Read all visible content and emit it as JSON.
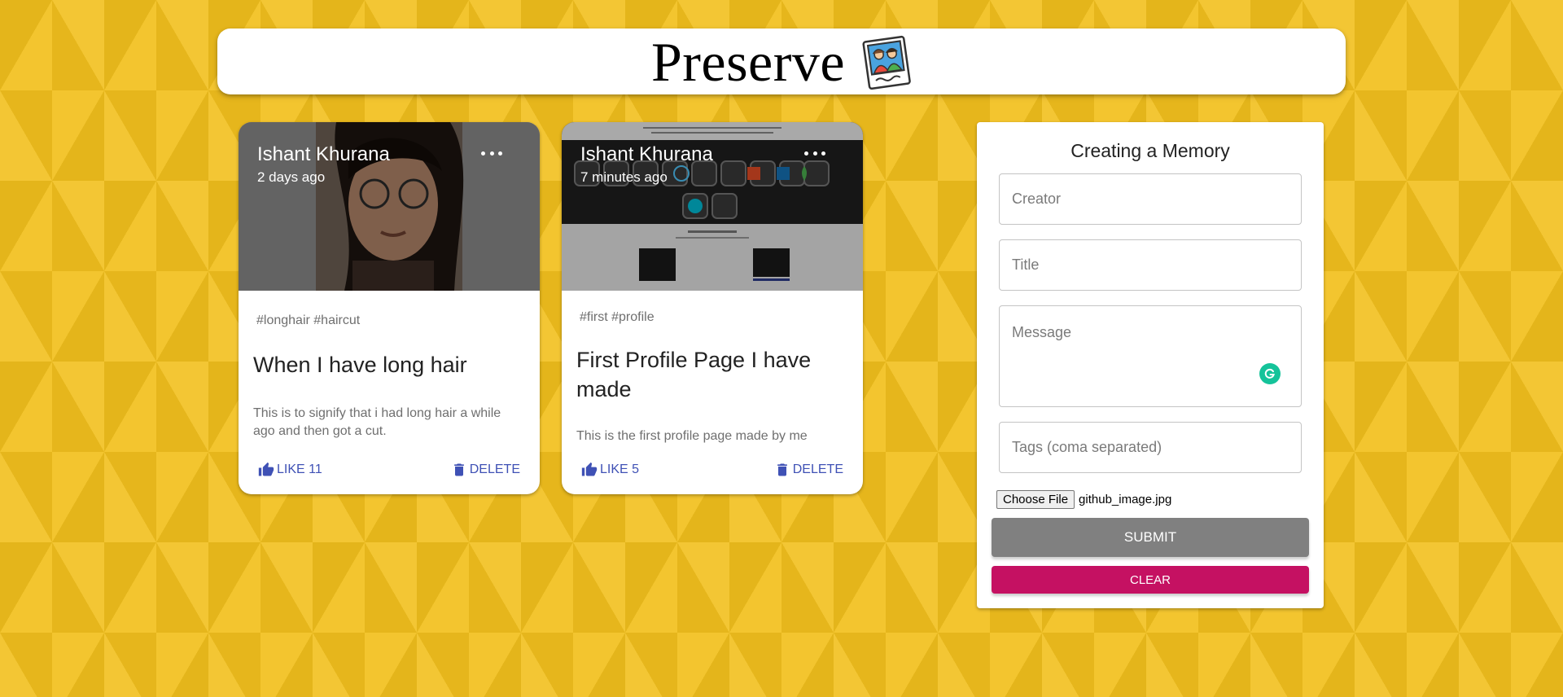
{
  "app": {
    "title": "Preserve",
    "logo_icon": "photo-album-icon"
  },
  "posts": [
    {
      "creator": "Ishant Khurana",
      "time_ago": "2 days ago",
      "tags": "#longhair #haircut",
      "title": "When I have long hair",
      "message": "This is to signify that i had long hair a while ago and then got a cut.",
      "like_label": "LIKE 11",
      "delete_label": "DELETE",
      "media_description": "selfie photo"
    },
    {
      "creator": "Ishant Khurana",
      "time_ago": "7 minutes ago",
      "tags": "#first #profile",
      "title": "First Profile Page I have made",
      "message": "This is the first profile page made by me",
      "like_label": "LIKE 5",
      "delete_label": "DELETE",
      "media_description": "github profile screenshot"
    }
  ],
  "form": {
    "heading": "Creating a Memory",
    "creator_placeholder": "Creator",
    "title_placeholder": "Title",
    "message_placeholder": "Message",
    "tags_placeholder": "Tags (coma separated)",
    "choose_file_label": "Choose File",
    "file_name": "github_image.jpg",
    "submit_label": "SUBMIT",
    "clear_label": "CLEAR"
  },
  "colors": {
    "background": "#f2c01d",
    "accent": "#3f51b5",
    "submit": "#808080",
    "clear": "#c51162",
    "grammarly": "#15c39a"
  }
}
